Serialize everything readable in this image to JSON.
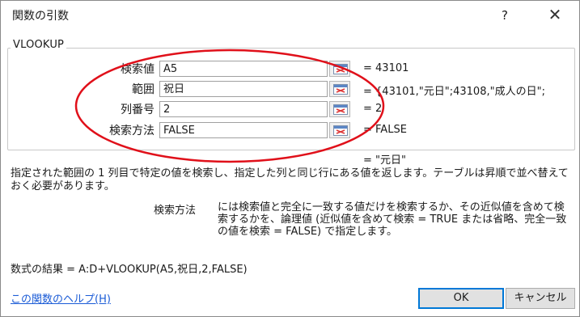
{
  "dialog": {
    "title": "関数の引数",
    "help_glyph": "?",
    "close_glyph": "✕"
  },
  "function": {
    "name": "VLOOKUP"
  },
  "arguments": [
    {
      "label": "検索値",
      "input": "A5",
      "value": "= 43101"
    },
    {
      "label": "範囲",
      "input": "祝日",
      "value": "= {43101,\"元日\";43108,\"成人の日\";"
    },
    {
      "label": "列番号",
      "input": "2",
      "value": "= 2"
    },
    {
      "label": "検索方法",
      "input": "FALSE",
      "value": "= FALSE"
    }
  ],
  "result_value": "= \"元日\"",
  "description": "指定された範囲の 1 列目で特定の値を検索し、指定した列と同じ行にある値を返します。テーブルは昇順で並べ替えておく必要があります。",
  "arg_help": {
    "name": "検索方法",
    "text": "には検索値と完全に一致する値だけを検索するか、その近似値を含めて検索するかを、論理値 (近似値を含めて検索 = TRUE または省略、完全一致の値を検索 = FALSE) で指定します。"
  },
  "formula_result": "数式の結果 = A:D+VLOOKUP(A5,祝日,2,FALSE)",
  "help_link": "この関数のヘルプ(H)",
  "buttons": {
    "ok": "OK",
    "cancel": "キャンセル"
  },
  "colors": {
    "annotation_ellipse": "#e0101a",
    "link": "#1a5bd6",
    "ok_border": "#0078d7"
  },
  "icons": {
    "ref_button": "collapse-dialog-icon"
  }
}
